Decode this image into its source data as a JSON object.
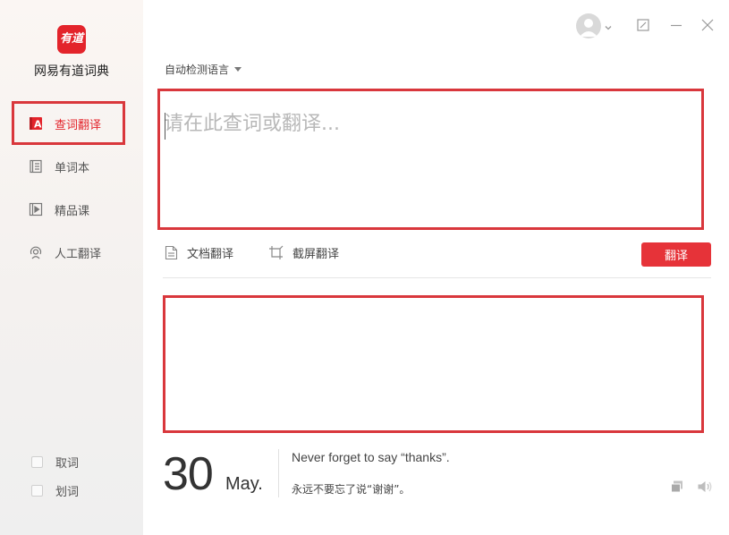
{
  "app": {
    "logo_text": "有道",
    "title": "网易有道词典"
  },
  "sidebar": {
    "items": [
      {
        "label": "查词翻译",
        "icon": "dictionary-a-icon",
        "active": true
      },
      {
        "label": "单词本",
        "icon": "notebook-icon",
        "active": false
      },
      {
        "label": "精品课",
        "icon": "video-course-icon",
        "active": false
      },
      {
        "label": "人工翻译",
        "icon": "human-translate-icon",
        "active": false
      }
    ],
    "options": [
      {
        "label": "取词",
        "checked": false
      },
      {
        "label": "划词",
        "checked": false
      }
    ]
  },
  "main": {
    "language_select": "自动检测语言",
    "input": {
      "placeholder": "请在此查词或翻译...",
      "value": ""
    },
    "tools": {
      "doc_translate": "文档翻译",
      "screenshot_translate": "截屏翻译"
    },
    "translate_button": "翻译",
    "result": ""
  },
  "daily": {
    "day": "30",
    "month": "May.",
    "sentence_en": "Never forget to say “thanks”.",
    "sentence_zh": "永远不要忘了说“谢谢”。"
  },
  "colors": {
    "brand_red": "#e3242b",
    "highlight_border": "#d9373c",
    "button_red": "#e63339"
  }
}
